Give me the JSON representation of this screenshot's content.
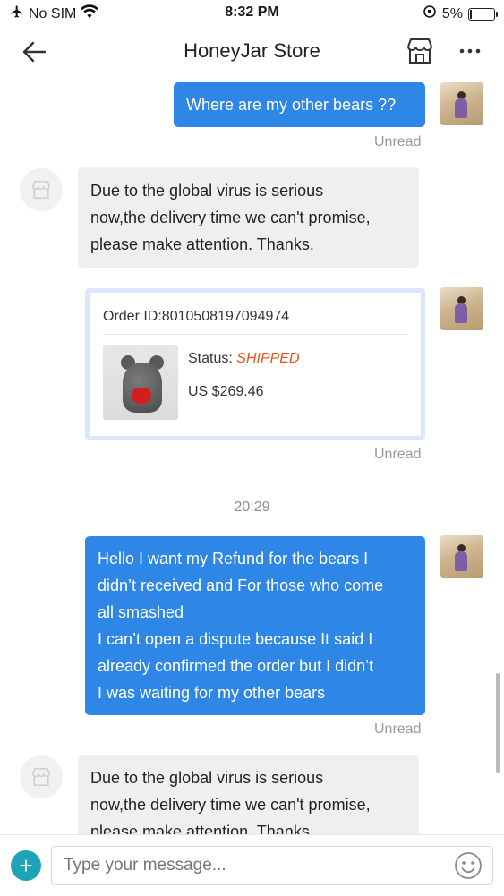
{
  "status_bar": {
    "carrier": "No SIM",
    "time": "8:32 PM",
    "battery": "5%"
  },
  "header": {
    "title": "HoneyJar Store"
  },
  "messages": [
    {
      "direction": "out",
      "text": "Where are my other bears ??",
      "status": "Unread"
    },
    {
      "direction": "in",
      "lines": [
        "Due to the global virus is serious",
        "now,the delivery time we can't promise,",
        "please make attention. Thanks."
      ]
    },
    {
      "direction": "out",
      "type": "order_card",
      "status": "Unread"
    },
    {
      "direction": "out",
      "lines": [
        "Hello I want my Refund for the bears I",
        "didn’t received and For those who come",
        "all smashed",
        "I can’t open a dispute because It said I",
        "already confirmed the order but I didn’t",
        "I was waiting for my other bears"
      ],
      "status": "Unread"
    },
    {
      "direction": "in",
      "lines": [
        "Due to the global virus is serious",
        "now,the delivery time we can't promise,",
        "please make attention. Thanks."
      ]
    }
  ],
  "timestamp": "20:29",
  "order": {
    "id_text": "Order ID:8010508197094974",
    "status_label": "Status:",
    "status_value": "SHIPPED",
    "price": "US $269.46"
  },
  "input": {
    "placeholder": "Type your message..."
  },
  "colors": {
    "outgoing_bubble": "#2e86e6",
    "incoming_bubble": "#efefef",
    "status_shipped": "#e8541e",
    "plus_button": "#1fa3b8"
  }
}
